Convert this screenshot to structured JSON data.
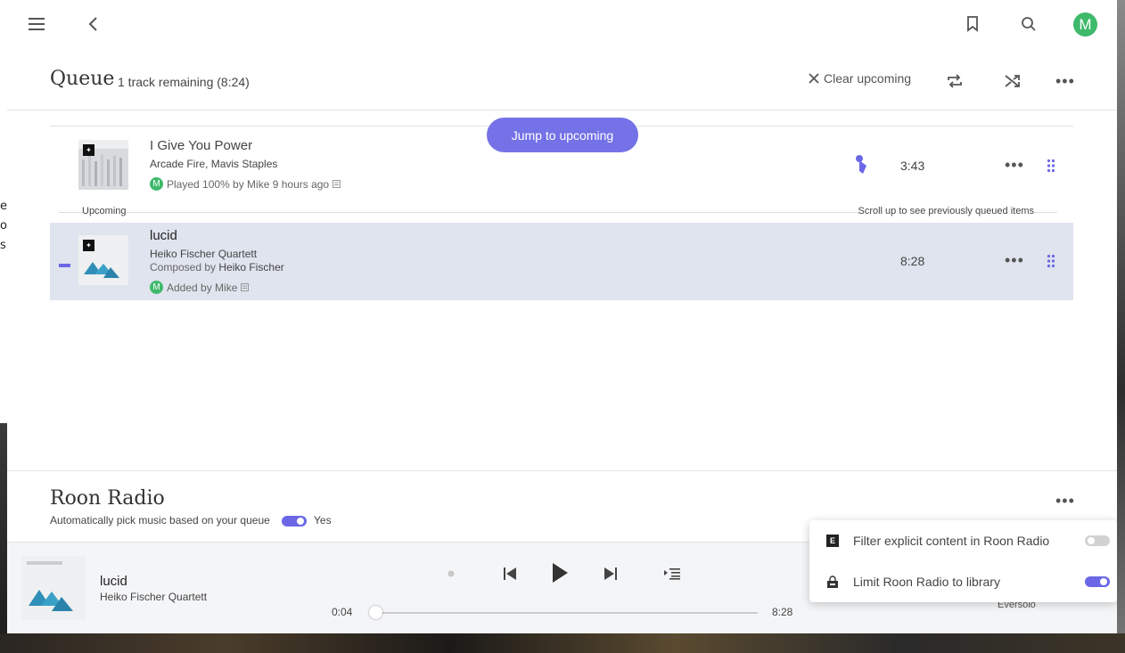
{
  "background": {
    "fragments": [
      "e",
      "or",
      "s"
    ]
  },
  "queue": {
    "title": "Queue",
    "remaining": "1 track remaining (8:24)",
    "clear_label": "Clear upcoming",
    "jump_label": "Jump to upcoming",
    "upcoming_label": "Upcoming",
    "scroll_hint": "Scroll up to see previously queued items"
  },
  "tracks": [
    {
      "title": "I Give You Power",
      "artists": [
        "Arcade Fire",
        "Mavis Staples"
      ],
      "artist_separator": ", ",
      "meta_avatar": "M",
      "meta": "Played 100% by Mike 9 hours ago",
      "duration": "3:43"
    },
    {
      "title": "lucid",
      "artist": "Heiko Fischer Quartett",
      "composed_prefix": "Composed by",
      "composer": "Heiko Fischer",
      "meta_avatar": "M",
      "meta": "Added by Mike",
      "duration": "8:28"
    }
  ],
  "topbar": {
    "avatar": "M"
  },
  "radio": {
    "title": "Roon Radio",
    "subtitle": "Automatically pick music based on your queue",
    "toggle_label": "Yes",
    "enabled": true
  },
  "player": {
    "title": "lucid",
    "artist": "Heiko Fischer Quartett",
    "elapsed": "0:04",
    "total": "8:28",
    "progress_fraction": 0.008,
    "zone": "Eversolo"
  },
  "popup": {
    "items": [
      {
        "icon": "explicit-icon",
        "glyph": "E",
        "label": "Filter explicit content in Roon Radio",
        "enabled": false
      },
      {
        "icon": "library-lock-icon",
        "label": "Limit Roon Radio to library",
        "enabled": true
      }
    ]
  },
  "colors": {
    "accent": "#6b67e6",
    "avatar": "#3fb96b",
    "current_row": "#dfe4ee"
  }
}
